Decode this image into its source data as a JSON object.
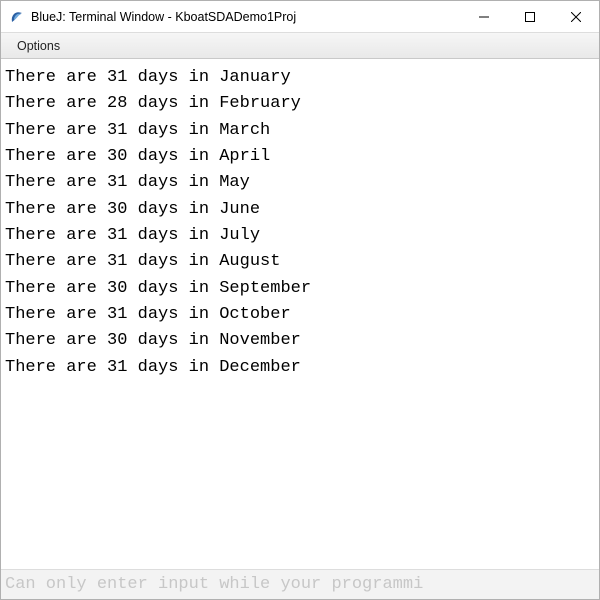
{
  "window": {
    "title": "BlueJ: Terminal Window - KboatSDADemo1Proj"
  },
  "menubar": {
    "options": "Options"
  },
  "output": {
    "lines": [
      "There are 31 days in January",
      "There are 28 days in February",
      "There are 31 days in March",
      "There are 30 days in April",
      "There are 31 days in May",
      "There are 30 days in June",
      "There are 31 days in July",
      "There are 31 days in August",
      "There are 30 days in September",
      "There are 31 days in October",
      "There are 30 days in November",
      "There are 31 days in December"
    ]
  },
  "input_hint": "Can only enter input while your programmi"
}
